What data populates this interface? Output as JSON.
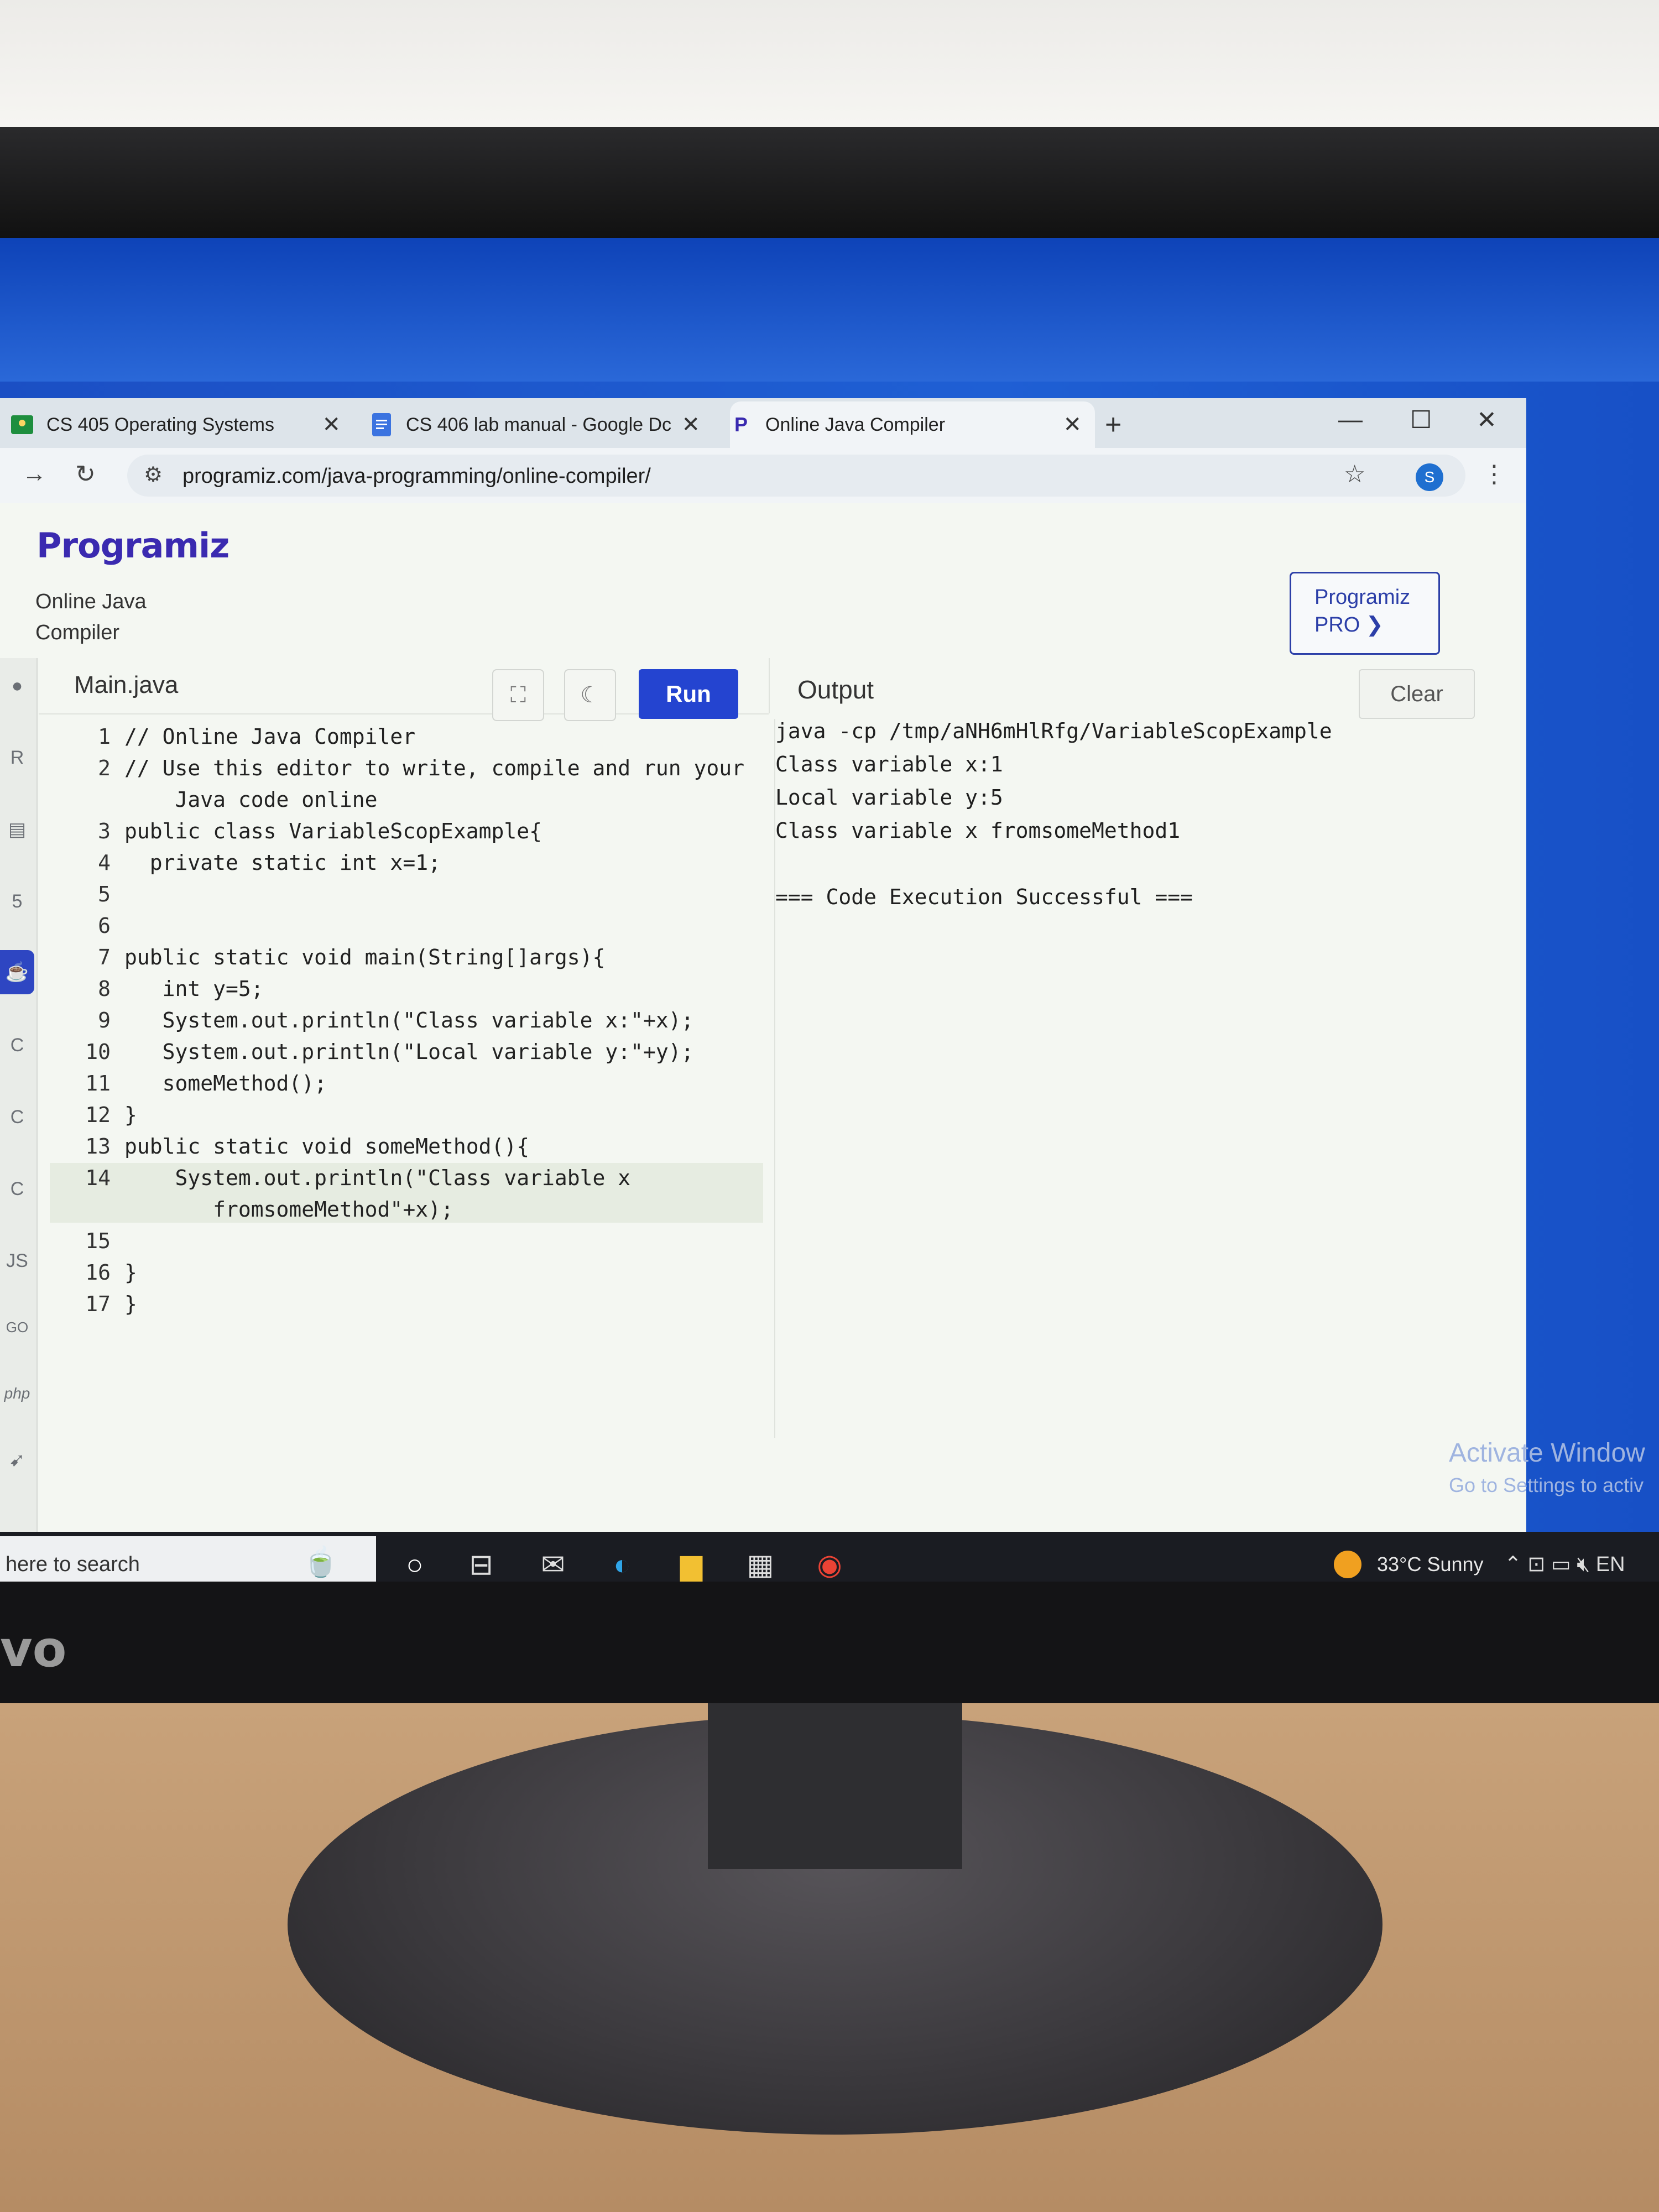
{
  "tabs": [
    {
      "label": "CS 405 Operating Systems"
    },
    {
      "label": "CS 406 lab manual - Google Dc"
    },
    {
      "label": "Online Java Compiler"
    }
  ],
  "address": {
    "url": "programiz.com/java-programming/online-compiler/"
  },
  "avatar": {
    "initial": "S"
  },
  "site": {
    "logo": "Programiz",
    "subtitle": "Online Java Compiler",
    "pro_button": "Programiz PRO ❯"
  },
  "editor": {
    "file_tab": "Main.java",
    "run_label": "Run",
    "lines": [
      {
        "n": "1",
        "text": "// Online Java Compiler"
      },
      {
        "n": "2",
        "text": "// Use this editor to write, compile and run your"
      },
      {
        "n": "",
        "text": "    Java code online"
      },
      {
        "n": "3",
        "text": "public class VariableScopExample{"
      },
      {
        "n": "4",
        "text": "  private static int x=1;"
      },
      {
        "n": "5",
        "text": ""
      },
      {
        "n": "6",
        "text": ""
      },
      {
        "n": "7",
        "text": "public static void main(String[]args){"
      },
      {
        "n": "8",
        "text": "   int y=5;"
      },
      {
        "n": "9",
        "text": "   System.out.println(\"Class variable x:\"+x);"
      },
      {
        "n": "10",
        "text": "   System.out.println(\"Local variable y:\"+y);"
      },
      {
        "n": "11",
        "text": "   someMethod();"
      },
      {
        "n": "12",
        "text": "}"
      },
      {
        "n": "13",
        "text": "public static void someMethod(){"
      },
      {
        "n": "14",
        "text": "    System.out.println(\"Class variable x"
      },
      {
        "n": "",
        "text": "       fromsomeMethod\"+x);"
      },
      {
        "n": "15",
        "text": ""
      },
      {
        "n": "16",
        "text": "}"
      },
      {
        "n": "17",
        "text": "}"
      }
    ]
  },
  "output": {
    "title": "Output",
    "clear_label": "Clear",
    "lines": [
      "java -cp /tmp/aNH6mHlRfg/VariableScopExample",
      "Class variable x:1",
      "Local variable y:5",
      "Class variable x fromsomeMethod1",
      "",
      "=== Code Execution Successful ==="
    ]
  },
  "sidebar": {
    "icons": [
      "python-icon",
      "r-icon",
      "sql-icon",
      "html-icon",
      "java-icon",
      "c-icon",
      "cpp-icon",
      "csharp-icon",
      "js-icon",
      "go-icon",
      "php-icon",
      "swift-icon"
    ],
    "js_label": "JS",
    "go_label": "GO",
    "php_label": "php"
  },
  "watermark": {
    "line1": "Activate Window",
    "line2": "Go to Settings to activ"
  },
  "taskbar": {
    "search_text": "here to search",
    "weather": "33°C  Sunny",
    "tray_lang": "EN"
  },
  "brand_text": "vo"
}
